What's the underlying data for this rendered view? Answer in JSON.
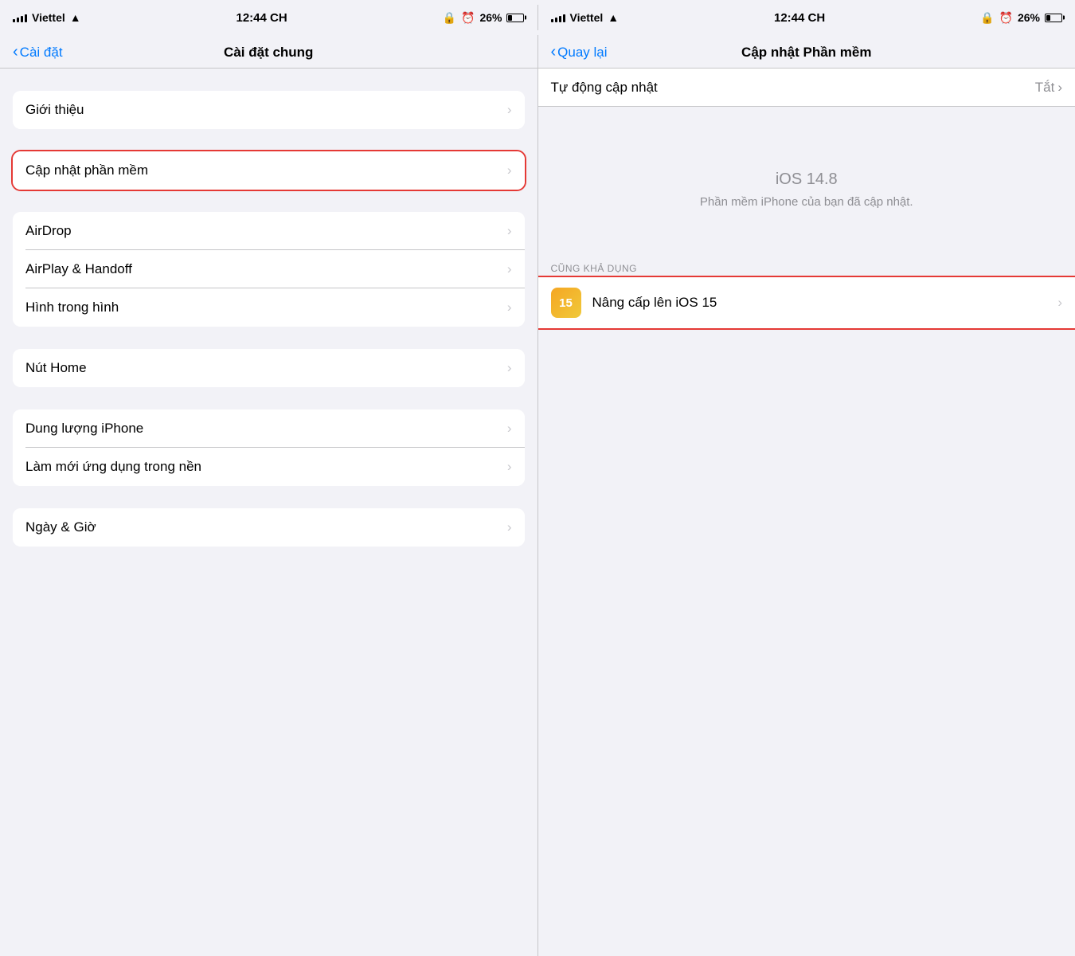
{
  "left_status": {
    "carrier": "Viettel",
    "wifi": "📶",
    "time": "12:44 CH",
    "lock_icon": "🔒",
    "alarm_icon": "⏰",
    "battery_pct": "26%"
  },
  "right_status": {
    "carrier": "Viettel",
    "wifi": "📶",
    "time": "12:44 CH",
    "lock_icon": "🔒",
    "alarm_icon": "⏰",
    "battery_pct": "26%"
  },
  "left_nav": {
    "back_label": "Cài đặt",
    "title": "Cài đặt chung"
  },
  "right_nav": {
    "back_label": "Quay lại",
    "title": "Cập nhật Phần mềm"
  },
  "left_items": [
    {
      "label": "Giới thiệu"
    },
    {
      "label": "Cập nhật phần mềm",
      "highlighted": true
    },
    {
      "label": "AirDrop"
    },
    {
      "label": "AirPlay & Handoff"
    },
    {
      "label": "Hình trong hình"
    },
    {
      "label": "Nút Home"
    },
    {
      "label": "Dung lượng iPhone"
    },
    {
      "label": "Làm mới ứng dụng trong nền"
    },
    {
      "label": "Ngày & Giờ"
    }
  ],
  "right_auto_update": {
    "label": "Tự động cập nhật",
    "value": "Tắt"
  },
  "right_ios_info": {
    "version": "iOS 14.8",
    "updated_text": "Phần mềm iPhone của bạn đã cập nhật."
  },
  "right_also_available": {
    "header": "CŨNG KHẢ DỤNG",
    "upgrade_badge": "15",
    "upgrade_label": "Nâng cấp lên iOS 15"
  }
}
